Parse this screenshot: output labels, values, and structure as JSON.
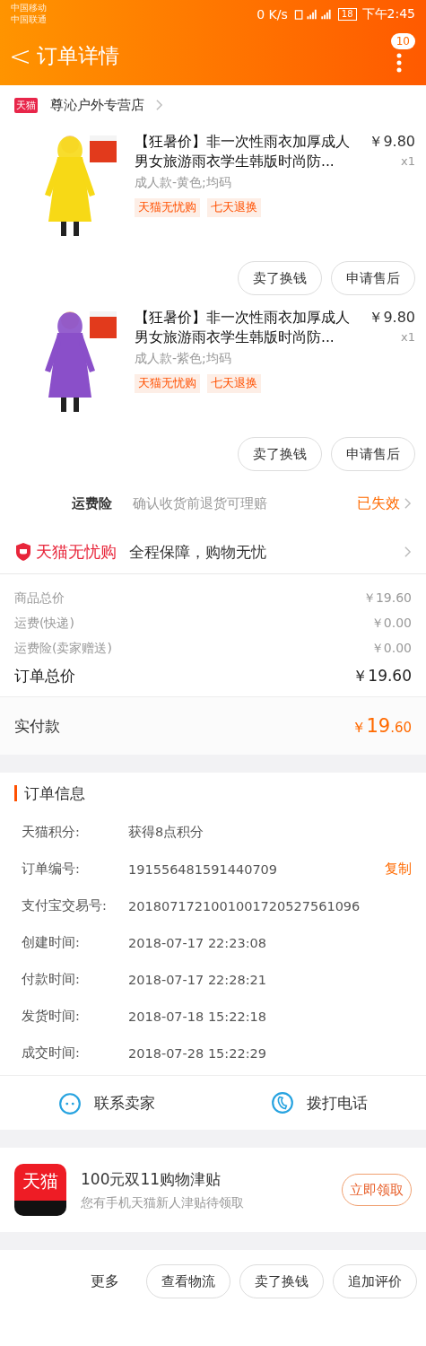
{
  "status_bar": {
    "carriers": [
      "中国移动",
      "中国联通"
    ],
    "speed": "0 K/s",
    "battery": "18",
    "time": "下午2:45"
  },
  "header": {
    "back": "<",
    "title": "订单详情",
    "badge": "10"
  },
  "shop": {
    "badge": "天猫",
    "name": "尊沁户外专营店"
  },
  "products": [
    {
      "title": "【狂暑价】非一次性雨衣加厚成人男女旅游雨衣学生韩版时尚防...",
      "price": "￥9.80",
      "qty": "x1",
      "sku": "成人款-黄色;均码",
      "tags": [
        "天猫无忧购",
        "七天退换"
      ],
      "buttons": [
        "卖了换钱",
        "申请售后"
      ]
    },
    {
      "title": "【狂暑价】非一次性雨衣加厚成人男女旅游雨衣学生韩版时尚防...",
      "price": "￥9.80",
      "qty": "x1",
      "sku": "成人款-紫色;均码",
      "tags": [
        "天猫无忧购",
        "七天退换"
      ],
      "buttons": [
        "卖了换钱",
        "申请售后"
      ]
    }
  ],
  "insurance": {
    "label": "运费险",
    "desc": "确认收货前退货可理赔",
    "status": "已失效"
  },
  "guarantee": {
    "brand": "天猫无忧购",
    "text": "全程保障，购物无忧"
  },
  "price_lines": [
    {
      "label": "商品总价",
      "value": "￥19.60"
    },
    {
      "label": "运费(快递)",
      "value": "￥0.00"
    },
    {
      "label": "运费险(卖家赠送)",
      "value": "￥0.00"
    }
  ],
  "order_total": {
    "label": "订单总价",
    "value": "￥19.60"
  },
  "paid": {
    "label": "实付款",
    "currency": "￥",
    "integer": "19",
    "decimal": ".60"
  },
  "order_info": {
    "title": "订单信息",
    "rows": [
      {
        "label": "天猫积分:",
        "value": "获得8点积分"
      },
      {
        "label": "订单编号:",
        "value": "191556481591440709",
        "action": "复制"
      },
      {
        "label": "支付宝交易号:",
        "value": "2018071721001001720527561096"
      },
      {
        "label": "创建时间:",
        "value": "2018-07-17 22:23:08"
      },
      {
        "label": "付款时间:",
        "value": "2018-07-17 22:28:21"
      },
      {
        "label": "发货时间:",
        "value": "2018-07-18 15:22:18"
      },
      {
        "label": "成交时间:",
        "value": "2018-07-28 15:22:29"
      }
    ]
  },
  "contact": [
    {
      "kind": "chat",
      "label": "联系卖家"
    },
    {
      "kind": "phone",
      "label": "拨打电话"
    }
  ],
  "promo": {
    "logo": "天猫",
    "title": "100元双11购物津贴",
    "subtitle": "您有手机天猫新人津贴待领取",
    "button": "立即领取"
  },
  "bottom_bar": {
    "more": "更多",
    "buttons": [
      "查看物流",
      "卖了换钱",
      "追加评价"
    ]
  }
}
